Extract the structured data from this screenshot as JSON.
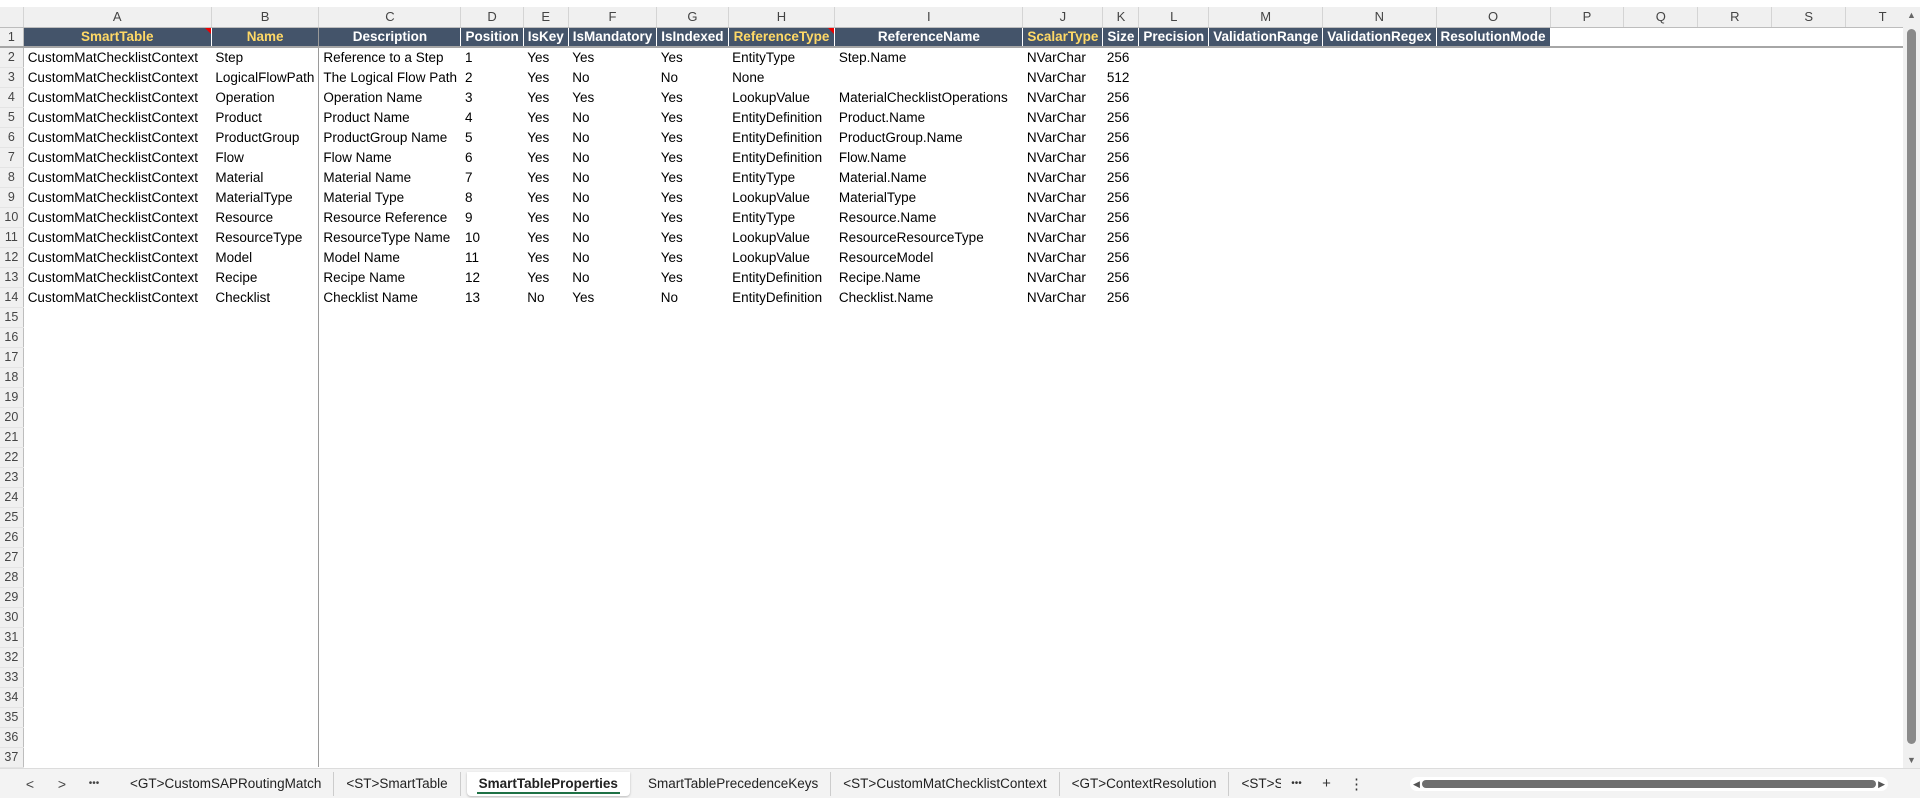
{
  "columns": [
    "A",
    "B",
    "C",
    "D",
    "E",
    "F",
    "G",
    "H",
    "I",
    "J",
    "K",
    "L",
    "M",
    "N",
    "O",
    "P",
    "Q",
    "R",
    "S",
    "T"
  ],
  "headers": [
    {
      "label": "SmartTable",
      "key": true,
      "note": true
    },
    {
      "label": "Name",
      "key": true
    },
    {
      "label": "Description"
    },
    {
      "label": "Position"
    },
    {
      "label": "IsKey"
    },
    {
      "label": "IsMandatory"
    },
    {
      "label": "IsIndexed"
    },
    {
      "label": "ReferenceType",
      "key": true,
      "note": true
    },
    {
      "label": "ReferenceName"
    },
    {
      "label": "ScalarType",
      "key": true
    },
    {
      "label": "Size"
    },
    {
      "label": "Precision"
    },
    {
      "label": "ValidationRange"
    },
    {
      "label": "ValidationRegex"
    },
    {
      "label": "ResolutionMode"
    }
  ],
  "rows": [
    [
      "CustomMatChecklistContext",
      "Step",
      "Reference to a Step",
      "1",
      "Yes",
      "Yes",
      "Yes",
      "EntityType",
      "Step.Name",
      "NVarChar",
      "256"
    ],
    [
      "CustomMatChecklistContext",
      "LogicalFlowPath",
      "The Logical Flow Path",
      "2",
      "Yes",
      "No",
      "No",
      "None",
      "",
      "NVarChar",
      "512"
    ],
    [
      "CustomMatChecklistContext",
      "Operation",
      "Operation Name",
      "3",
      "Yes",
      "Yes",
      "Yes",
      "LookupValue",
      "MaterialChecklistOperations",
      "NVarChar",
      "256"
    ],
    [
      "CustomMatChecklistContext",
      "Product",
      "Product Name",
      "4",
      "Yes",
      "No",
      "Yes",
      "EntityDefinition",
      "Product.Name",
      "NVarChar",
      "256"
    ],
    [
      "CustomMatChecklistContext",
      "ProductGroup",
      "ProductGroup Name",
      "5",
      "Yes",
      "No",
      "Yes",
      "EntityDefinition",
      "ProductGroup.Name",
      "NVarChar",
      "256"
    ],
    [
      "CustomMatChecklistContext",
      "Flow",
      "Flow Name",
      "6",
      "Yes",
      "No",
      "Yes",
      "EntityDefinition",
      "Flow.Name",
      "NVarChar",
      "256"
    ],
    [
      "CustomMatChecklistContext",
      "Material",
      "Material Name",
      "7",
      "Yes",
      "No",
      "Yes",
      "EntityType",
      "Material.Name",
      "NVarChar",
      "256"
    ],
    [
      "CustomMatChecklistContext",
      "MaterialType",
      "Material Type",
      "8",
      "Yes",
      "No",
      "Yes",
      "LookupValue",
      "MaterialType",
      "NVarChar",
      "256"
    ],
    [
      "CustomMatChecklistContext",
      "Resource",
      "Resource Reference",
      "9",
      "Yes",
      "No",
      "Yes",
      "EntityType",
      "Resource.Name",
      "NVarChar",
      "256"
    ],
    [
      "CustomMatChecklistContext",
      "ResourceType",
      "ResourceType Name",
      "10",
      "Yes",
      "No",
      "Yes",
      "LookupValue",
      "ResourceResourceType",
      "NVarChar",
      "256"
    ],
    [
      "CustomMatChecklistContext",
      "Model",
      "Model Name",
      "11",
      "Yes",
      "No",
      "Yes",
      "LookupValue",
      "ResourceModel",
      "NVarChar",
      "256"
    ],
    [
      "CustomMatChecklistContext",
      "Recipe",
      "Recipe Name",
      "12",
      "Yes",
      "No",
      "Yes",
      "EntityDefinition",
      "Recipe.Name",
      "NVarChar",
      "256"
    ],
    [
      "CustomMatChecklistContext",
      "Checklist",
      "Checklist Name",
      "13",
      "No",
      "Yes",
      "No",
      "EntityDefinition",
      "Checklist.Name",
      "NVarChar",
      "256"
    ]
  ],
  "row_count": 37,
  "tabs": {
    "prev": "<",
    "next": ">",
    "more": "•••",
    "items": [
      "<GT>CustomSAPRoutingMatch",
      "<ST>SmartTable",
      "SmartTableProperties",
      "SmartTablePrecedenceKeys",
      "<ST>CustomMatChecklistContext",
      "<GT>ContextResolution",
      "<ST>Se"
    ],
    "active_index": 2,
    "more_right": "•••",
    "add": "+",
    "options": "⋮"
  },
  "colors": {
    "header_bg": "#44546a",
    "key_text": "#ffd966",
    "active_tab_underline": "#1e7145"
  }
}
